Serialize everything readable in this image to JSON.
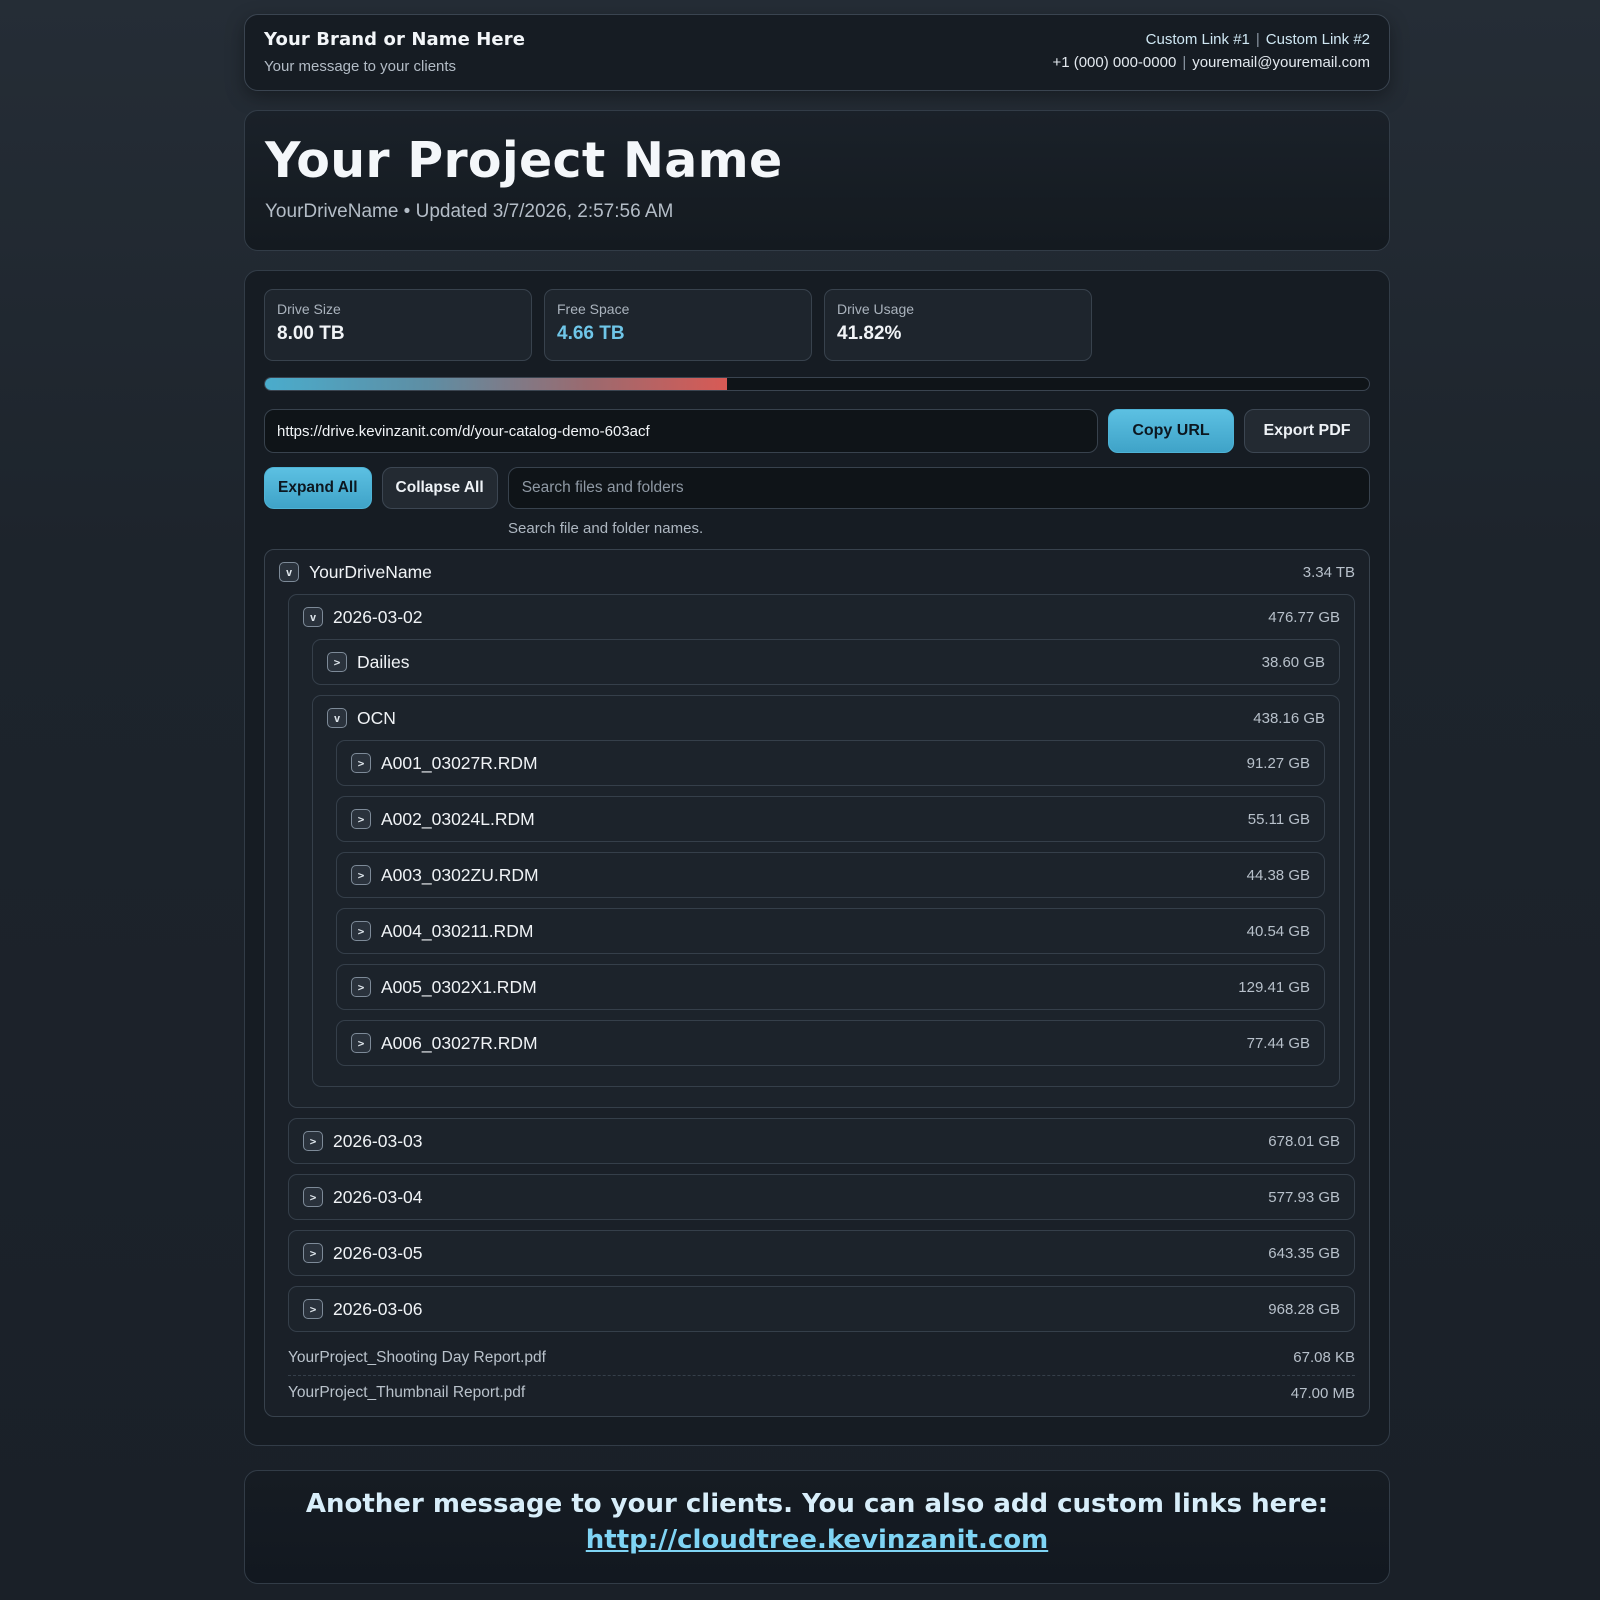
{
  "brand": {
    "name": "Your Brand or Name Here",
    "message": "Your message to your clients",
    "link1": "Custom Link #1",
    "link2": "Custom Link #2",
    "separator": "|",
    "phone": "+1 (000) 000-0000",
    "email": "youremail@youremail.com"
  },
  "project": {
    "title": "Your Project Name",
    "meta": "YourDriveName • Updated 3/7/2026, 2:57:56 AM"
  },
  "stats": {
    "drive_size_label": "Drive Size",
    "drive_size_value": "8.00 TB",
    "free_space_label": "Free Space",
    "free_space_value": "4.66 TB",
    "usage_label": "Drive Usage",
    "usage_value": "41.82%",
    "usage_fraction": 0.4182
  },
  "share": {
    "url": "https://drive.kevinzanit.com/d/your-catalog-demo-603acf",
    "copy_label": "Copy URL",
    "export_label": "Export PDF"
  },
  "controls": {
    "expand_label": "Expand All",
    "collapse_label": "Collapse All",
    "search_placeholder": "Search files and folders",
    "search_hint": "Search file and folder names."
  },
  "tree": {
    "root": {
      "name": "YourDriveName",
      "size": "3.34 TB",
      "toggle": "v"
    },
    "day1": {
      "name": "2026-03-02",
      "size": "476.77 GB",
      "toggle": "v"
    },
    "dailies": {
      "name": "Dailies",
      "size": "38.60 GB",
      "toggle": ">"
    },
    "ocn": {
      "name": "OCN",
      "size": "438.16 GB",
      "toggle": "v"
    },
    "clips": [
      {
        "name": "A001_03027R.RDM",
        "size": "91.27 GB",
        "toggle": ">"
      },
      {
        "name": "A002_03024L.RDM",
        "size": "55.11 GB",
        "toggle": ">"
      },
      {
        "name": "A003_0302ZU.RDM",
        "size": "44.38 GB",
        "toggle": ">"
      },
      {
        "name": "A004_030211.RDM",
        "size": "40.54 GB",
        "toggle": ">"
      },
      {
        "name": "A005_0302X1.RDM",
        "size": "129.41 GB",
        "toggle": ">"
      },
      {
        "name": "A006_03027R.RDM",
        "size": "77.44 GB",
        "toggle": ">"
      }
    ],
    "days": [
      {
        "name": "2026-03-03",
        "size": "678.01 GB",
        "toggle": ">"
      },
      {
        "name": "2026-03-04",
        "size": "577.93 GB",
        "toggle": ">"
      },
      {
        "name": "2026-03-05",
        "size": "643.35 GB",
        "toggle": ">"
      },
      {
        "name": "2026-03-06",
        "size": "968.28 GB",
        "toggle": ">"
      }
    ],
    "files": [
      {
        "name": "YourProject_Shooting Day Report.pdf",
        "size": "67.08 KB"
      },
      {
        "name": "YourProject_Thumbnail Report.pdf",
        "size": "47.00 MB"
      }
    ]
  },
  "footer": {
    "message": "Another message to your clients. You can also add custom links here:",
    "link": "http://cloudtree.kevinzanit.com"
  }
}
